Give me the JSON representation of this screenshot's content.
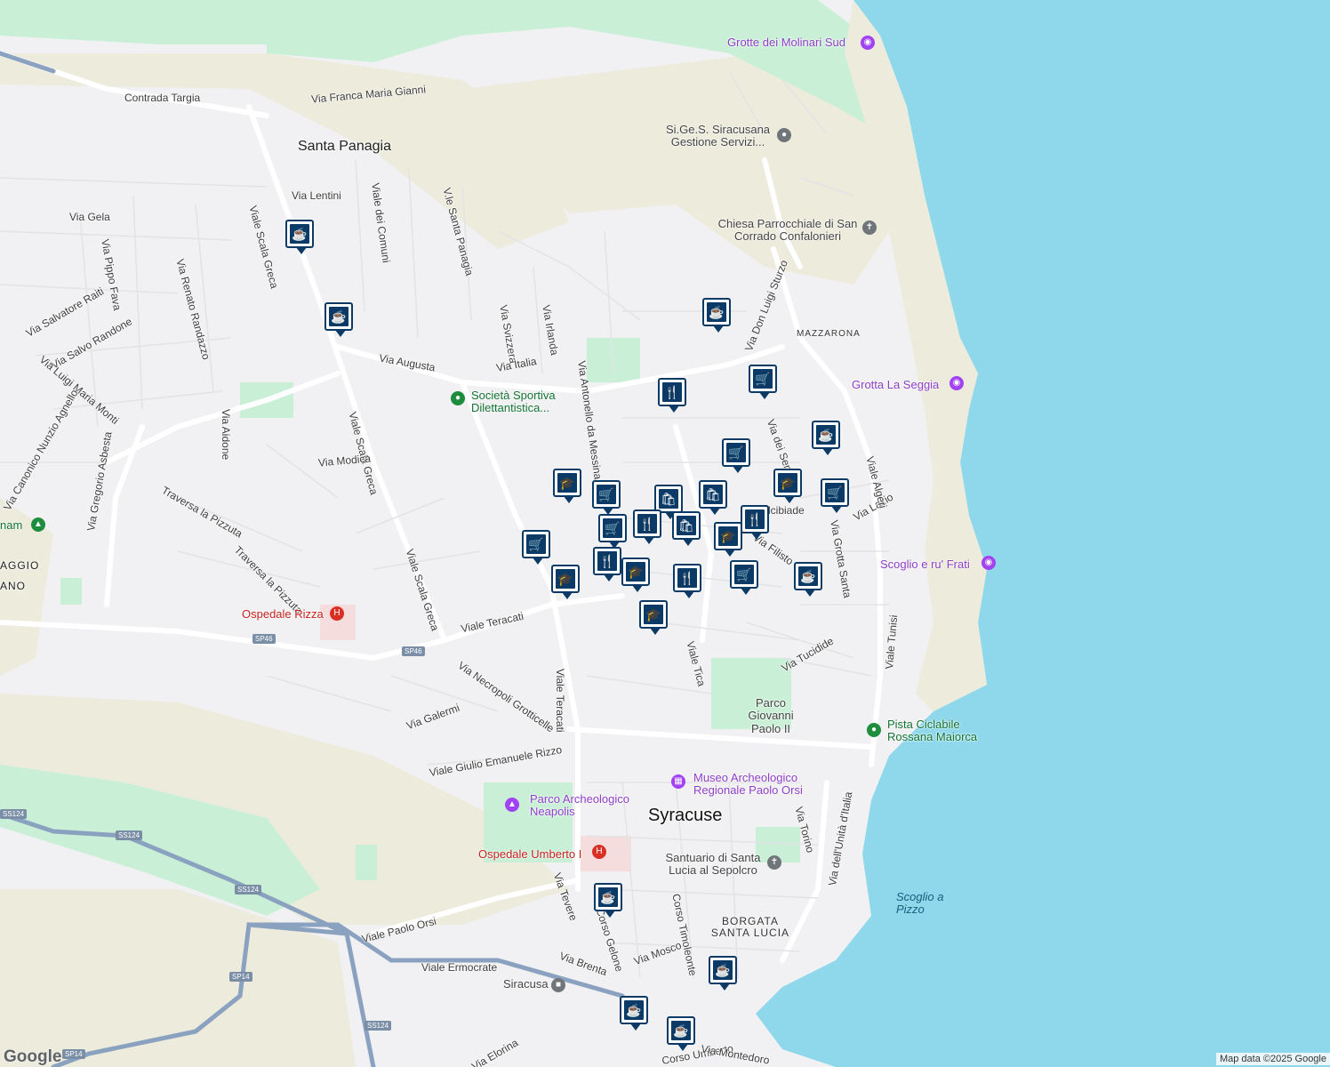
{
  "map": {
    "attribution": "Map data ©2025 Google",
    "logo": "Google",
    "colors": {
      "sea": "#8fd8ec",
      "land": "#f1f1f3",
      "park": "#c9f0d7",
      "road": "#ffffff",
      "major_road": "#8aa2c0",
      "marker": "#0b3a66"
    }
  },
  "labels": {
    "contrada_targia": "Contrada Targia",
    "via_franca": "Via Franca Maria Gianni",
    "santa_panagia": "Santa Panagia",
    "via_lentini": "Via Lentini",
    "viale_greca": "Viale Scala Greca",
    "via_gela": "Via Gela",
    "viale_comuni": "Viale dei Comuni",
    "viale_santa_panagia": "V.le Santa Panagia",
    "via_pippo_fava": "Via Pippo Fava",
    "via_renato": "Via Renato Randazzo",
    "via_salvatore_raiti": "Via Salvatore Raiti",
    "via_salvo_randone": "Via Salvo Randone",
    "via_luigi_monti": "Via Luigi Maria Monti",
    "via_svizzera": "Via Svizzera",
    "via_irlanda": "Via Irlanda",
    "via_augusta": "Via Augusta",
    "via_italia": "Via Italia",
    "via_antonello": "Via Antonello da Messina",
    "societa_sportiva": "Società Sportiva Dilettantistica...",
    "viale_scala_greca_2": "Viale Scala Greca",
    "via_aidone": "Via Aidone",
    "via_modica": "Via Modica",
    "via_canonico": "Via Canonico Nunzio Agnello",
    "via_gregorio": "Via Gregorio Asbesta",
    "traversa_pizzuta_1": "Traversa la Pizzuta",
    "traversa_pizzuta_2": "Traversa la Pizzuta",
    "viale_scala_greca_3": "Viale Scala Greca",
    "ospedale_rizza": "Ospedale Rizza",
    "sp46_a": "SP46",
    "sp46_b": "SP46",
    "viale_teracati": "Viale Teracati",
    "viale_teracati_2": "Viale Teracati",
    "via_necropoli": "Via Necropoli Grotticelle",
    "via_galermi": "Via Galermi",
    "viale_giulio": "Viale Giulio Emanuele Rizzo",
    "viale_tica": "Viale Tica",
    "via_tucidide": "Via Tucidide",
    "parco_giovanni": "Parco Giovanni Paolo II",
    "museo": "Museo Archeologico Regionale Paolo Orsi",
    "parco_arch": "Parco Archeologico Neapolis",
    "syracuse": "Syracuse",
    "ospedale_umberto": "Ospedale Umberto I",
    "santuario": "Santuario di Santa Lucia al Sepolcro",
    "via_torino": "Via Torino",
    "via_unita": "Via dell'Unità d'Italia",
    "borgata": "BORGATA SANTA LUCIA",
    "scoglio_pizzo": "Scoglio a Pizzo",
    "viale_paolo_orsi": "Viale Paolo Orsi",
    "via_tevere": "Via Tevere",
    "corso_gelone": "Corso Gelone",
    "via_mosco": "Via Mosco",
    "corso_timoleonte": "Corso Timoleonte",
    "viale_ermocrate": "Viale Ermocrate",
    "via_brenta": "Via Brenta",
    "siracusa": "Siracusa",
    "via_elorina": "Via Elorina",
    "corso_umberto": "Corso Umberto",
    "via_montedoro": "Via Montedoro",
    "ss124_a": "SS124",
    "ss124_b": "SS124",
    "ss124_c": "SS124",
    "ss124_d": "SS124",
    "sp14_a": "SP14",
    "sp14_b": "SP14",
    "pista_ciclabile": "Pista Ciclabile Rossana Maiorca",
    "viale_tunisi": "Viale Tunisi",
    "scoglio_frati": "Scoglio e ru' Frati",
    "via_grotta_santa": "Via Grotta Santa",
    "via_lazio": "Via Lazio",
    "viale_algeri": "Viale Algeri",
    "grotta_seggia": "Grotta La Seggia",
    "mazzarona": "MAZZARONA",
    "via_don_luigi": "Via Don Luigi Sturzo",
    "chiesa": "Chiesa Parrocchiale di San Corrado Confalonieri",
    "sigess": "Si.Ge.S. Siracusana Gestione Servizi...",
    "grotte_molinari": "Grotte dei Molinari Sud",
    "via_dei_servi": "Via dei Servi",
    "via_filisto": "Via Filisto",
    "alcibiade": "Alcibiade",
    "villaggio": "AGGIO",
    "villaggio2": "ANO",
    "panam": "nam"
  },
  "markers": [
    {
      "name": "cafe",
      "glyph": "☕"
    },
    {
      "name": "cafe",
      "glyph": "☕"
    },
    {
      "name": "cafe",
      "glyph": "☕"
    },
    {
      "name": "restaurant",
      "glyph": "🍴"
    },
    {
      "name": "grocery",
      "glyph": "🛒"
    },
    {
      "name": "cafe",
      "glyph": "☕"
    },
    {
      "name": "grocery",
      "glyph": "🛒"
    },
    {
      "name": "school",
      "glyph": "🎓"
    },
    {
      "name": "grocery",
      "glyph": "🛒"
    },
    {
      "name": "school",
      "glyph": "🎓"
    },
    {
      "name": "grocery",
      "glyph": "🛒"
    },
    {
      "name": "shopping",
      "glyph": "🛍"
    },
    {
      "name": "shopping",
      "glyph": "🛍"
    },
    {
      "name": "grocery",
      "glyph": "🛒"
    },
    {
      "name": "restaurant",
      "glyph": "🍴"
    },
    {
      "name": "shopping",
      "glyph": "🛍"
    },
    {
      "name": "grocery",
      "glyph": "🛒"
    },
    {
      "name": "restaurant",
      "glyph": "🍴"
    },
    {
      "name": "school",
      "glyph": "🎓"
    },
    {
      "name": "grocery",
      "glyph": "🛒"
    },
    {
      "name": "restaurant",
      "glyph": "🍴"
    },
    {
      "name": "school",
      "glyph": "🎓"
    },
    {
      "name": "school",
      "glyph": "🎓"
    },
    {
      "name": "restaurant",
      "glyph": "🍴"
    },
    {
      "name": "grocery",
      "glyph": "🛒"
    },
    {
      "name": "cafe",
      "glyph": "☕"
    },
    {
      "name": "school",
      "glyph": "🎓"
    },
    {
      "name": "cafe",
      "glyph": "☕"
    },
    {
      "name": "cafe",
      "glyph": "☕"
    },
    {
      "name": "cafe",
      "glyph": "☕"
    },
    {
      "name": "cafe",
      "glyph": "☕"
    }
  ]
}
